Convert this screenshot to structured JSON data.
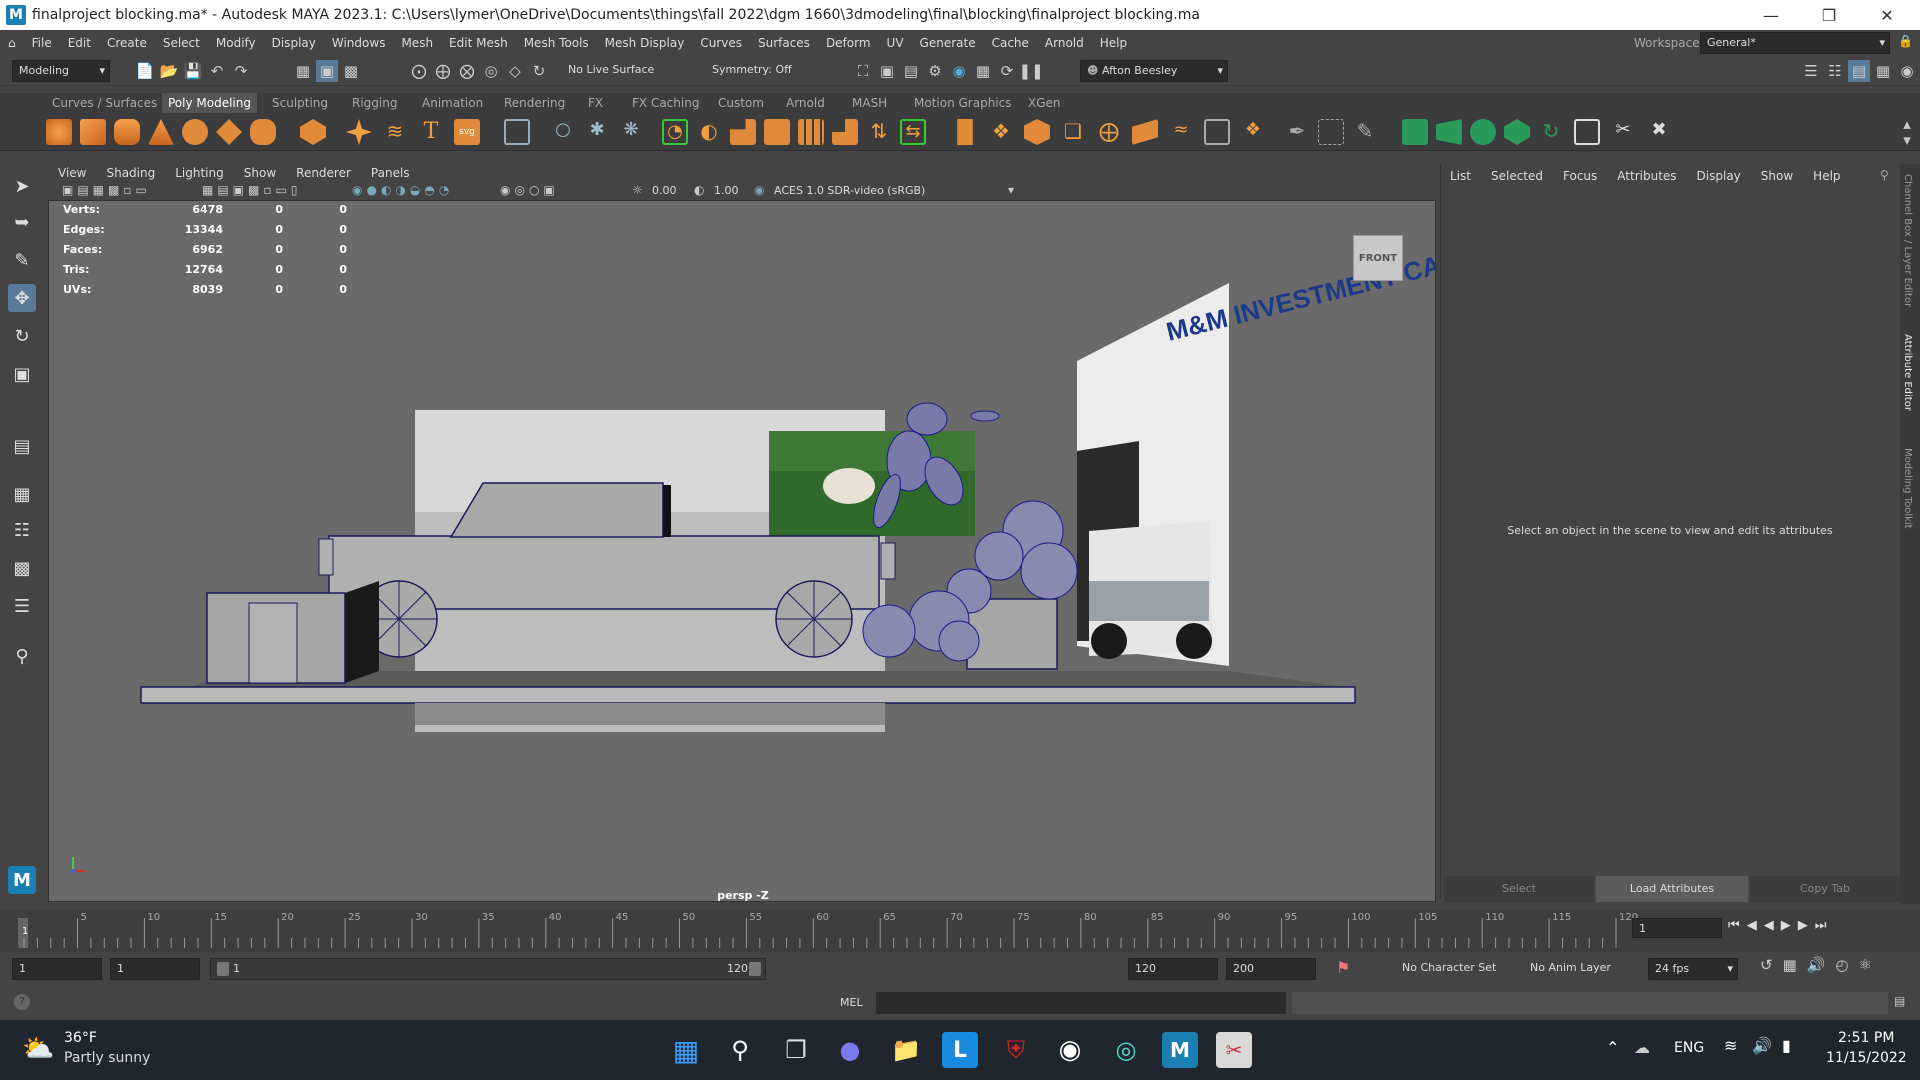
{
  "window": {
    "title": "finalproject blocking.ma* - Autodesk MAYA 2023.1: C:\\Users\\lymer\\OneDrive\\Documents\\things\\fall 2022\\dgm 1660\\3dmodeling\\final\\blocking\\finalproject blocking.ma",
    "logo": "M"
  },
  "menubar": {
    "items": [
      "File",
      "Edit",
      "Create",
      "Select",
      "Modify",
      "Display",
      "Windows",
      "Mesh",
      "Edit Mesh",
      "Mesh Tools",
      "Mesh Display",
      "Curves",
      "Surfaces",
      "Deform",
      "UV",
      "Generate",
      "Cache",
      "Arnold",
      "Help"
    ],
    "workspace_label": "Workspace:",
    "workspace_value": "General*"
  },
  "statusline": {
    "mode": "Modeling",
    "live_surface": "No Live Surface",
    "symmetry": "Symmetry: Off",
    "user": "Afton Beesley"
  },
  "shelf_tabs": [
    "Curves / Surfaces",
    "Poly Modeling",
    "Sculpting",
    "Rigging",
    "Animation",
    "Rendering",
    "FX",
    "FX Caching",
    "Custom",
    "Arnold",
    "MASH",
    "Motion Graphics",
    "XGen"
  ],
  "shelf_active": "Poly Modeling",
  "viewport": {
    "menu": [
      "View",
      "Shading",
      "Lighting",
      "Show",
      "Renderer",
      "Panels"
    ],
    "exposure": "0.00",
    "gamma": "1.00",
    "colorspace": "ACES 1.0 SDR-video (sRGB)",
    "camera_label": "persp -Z",
    "viewcube": "FRONT",
    "hud": [
      {
        "label": "Verts:",
        "values": [
          "6478",
          "0",
          "0"
        ]
      },
      {
        "label": "Edges:",
        "values": [
          "13344",
          "0",
          "0"
        ]
      },
      {
        "label": "Faces:",
        "values": [
          "6962",
          "0",
          "0"
        ]
      },
      {
        "label": "Tris:",
        "values": [
          "12764",
          "0",
          "0"
        ]
      },
      {
        "label": "UVs:",
        "values": [
          "8039",
          "0",
          "0"
        ]
      }
    ],
    "billboard_text": "M&M INVESTMENT CA"
  },
  "attribute_editor": {
    "menu": [
      "List",
      "Selected",
      "Focus",
      "Attributes",
      "Display",
      "Show",
      "Help"
    ],
    "message": "Select an object in the scene to view and edit its attributes",
    "buttons": [
      "Select",
      "Load Attributes",
      "Copy Tab"
    ],
    "side_tabs": [
      "Channel Box / Layer Editor",
      "Attribute Editor",
      "Modeling Toolkit"
    ]
  },
  "timeline": {
    "ticks": [
      "5",
      "10",
      "15",
      "20",
      "25",
      "30",
      "35",
      "40",
      "45",
      "50",
      "55",
      "60",
      "65",
      "70",
      "75",
      "80",
      "85",
      "90",
      "95",
      "100",
      "105",
      "110",
      "115",
      "120"
    ],
    "current_frame": "1",
    "first_tick": "1"
  },
  "range": {
    "start": "1",
    "playback_start": "1",
    "slider_start": "1",
    "slider_end": "120",
    "playback_end": "120",
    "end": "200",
    "character_set": "No Character Set",
    "anim_layer": "No Anim Layer",
    "fps": "24 fps"
  },
  "cmdline": {
    "lang": "MEL"
  },
  "taskbar": {
    "temp": "36°F",
    "weather": "Partly sunny",
    "lang": "ENG",
    "time": "2:51 PM",
    "date": "11/15/2022"
  }
}
